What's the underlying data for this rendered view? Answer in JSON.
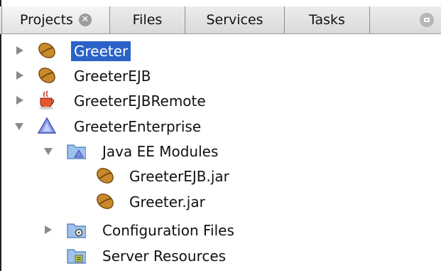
{
  "tabs": [
    {
      "label": "Projects",
      "active": true,
      "closable": true
    },
    {
      "label": "Files",
      "active": false
    },
    {
      "label": "Services",
      "active": false
    },
    {
      "label": "Tasks",
      "active": false
    }
  ],
  "tree": [
    {
      "label": "Greeter",
      "icon": "bean-icon",
      "expanded": false,
      "selected": true
    },
    {
      "label": "GreeterEJB",
      "icon": "bean-icon",
      "expanded": false
    },
    {
      "label": "GreeterEJBRemote",
      "icon": "coffee-cup-icon",
      "expanded": false
    },
    {
      "label": "GreeterEnterprise",
      "icon": "enterprise-triangle-icon",
      "expanded": true
    },
    {
      "label": "Java EE Modules",
      "icon": "modules-folder-icon",
      "expanded": true
    },
    {
      "label": "GreeterEJB.jar",
      "icon": "bean-icon"
    },
    {
      "label": "Greeter.jar",
      "icon": "bean-icon"
    },
    {
      "label": "Configuration Files",
      "icon": "config-folder-icon",
      "expanded": false
    },
    {
      "label": "Server Resources",
      "icon": "server-folder-icon"
    }
  ],
  "colors": {
    "selection": "#2a62c8",
    "bean": "#c98a2a",
    "triangle": "#6b7fd8",
    "folder": "#8fb6e6"
  }
}
